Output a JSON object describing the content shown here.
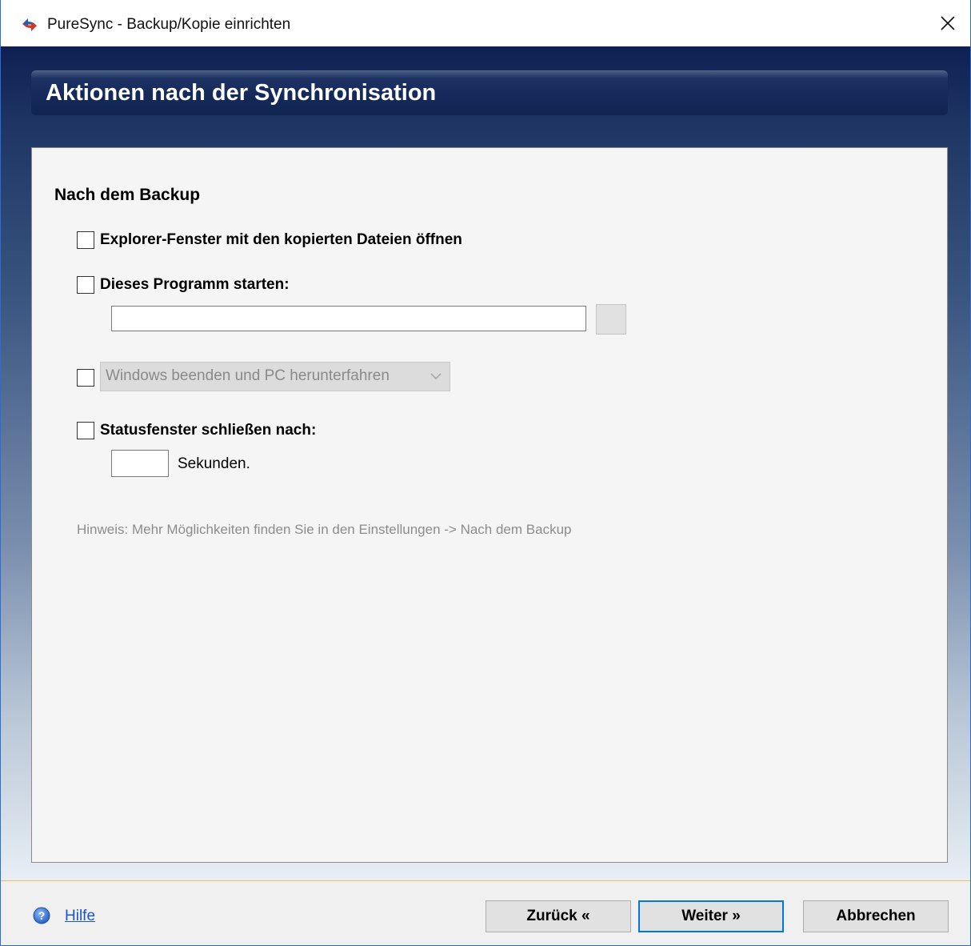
{
  "window": {
    "title": "PureSync - Backup/Kopie einrichten"
  },
  "header": {
    "title": "Aktionen nach der Synchronisation"
  },
  "section": {
    "title": "Nach dem Backup"
  },
  "options": {
    "explorer": {
      "label": "Explorer-Fenster mit den kopierten Dateien öffnen",
      "checked": false
    },
    "program": {
      "label": "Dieses Programm starten:",
      "checked": false,
      "path_value": ""
    },
    "shutdown": {
      "checked": false,
      "selected_option": "Windows beenden und PC herunterfahren"
    },
    "statuswindow": {
      "label": "Statusfenster schließen nach:",
      "checked": false,
      "seconds_value": "",
      "unit_label": "Sekunden."
    }
  },
  "hint": "Hinweis:  Mehr Möglichkeiten finden Sie in den Einstellungen -> Nach dem Backup",
  "footer": {
    "help_label": "Hilfe",
    "back_label": "Zurück «",
    "next_label": "Weiter »",
    "cancel_label": "Abbrechen"
  },
  "colors": {
    "header_bg": "#14295a",
    "link": "#1a57c6",
    "default_button_border": "#0078d7",
    "hint_text": "#8c8c8c"
  },
  "icons": {
    "app": "puresync-logo-icon",
    "close": "close-icon",
    "help": "help-circle-icon",
    "combo": "chevron-down-icon"
  }
}
